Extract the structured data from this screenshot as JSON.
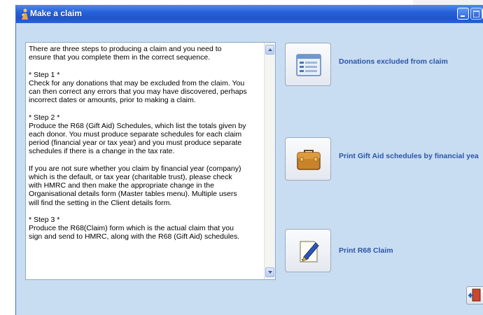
{
  "window": {
    "title": "Make a claim",
    "controls": [
      "minimize-icon",
      "maximize-icon",
      "close-icon"
    ]
  },
  "instructions": {
    "text": "There are three steps to producing a claim and you need to\nensure that you complete them in the correct sequence.\n\n* Step 1 *\nCheck for any donations that may be excluded from the claim. You\ncan then correct any errors that you may have discovered, perhaps\nincorrect dates or amounts, prior to making a claim.\n\n* Step 2 *\nProduce the R68 (Gift Aid) Schedules, which list the totals given by\neach donor. You must produce separate schedules for each claim\nperiod (financial year or tax year) and you must produce separate\nschedules if there is a change in the tax rate.\n\nIf you are not sure whether you claim by financial year (company)\nwhich is the default, or tax year (charitable trust), please check\nwith HMRC and then make the appropriate change in the\nOrganisational details form (Master tables menu). Multiple users\nwill find the setting in the Client details form.\n\n* Step 3 *\nProduce the R68(Claim) form which is the actual claim that you\nsign and send to HMRC, along with the R68 (Gift Aid) schedules."
  },
  "actions": {
    "donations_label": "Donations excluded from claim",
    "giftaid_label": "Print Gift Aid schedules by financial yea",
    "r68_label": "Print R68 Claim"
  },
  "icons": {
    "donations": "list-form-icon",
    "giftaid": "briefcase-icon",
    "r68": "pen-document-icon",
    "exit": "exit-door-icon"
  },
  "colors": {
    "titlebar": "#2660d8",
    "window_bg": "#c9ddf2",
    "action_label": "#2b55a8"
  }
}
